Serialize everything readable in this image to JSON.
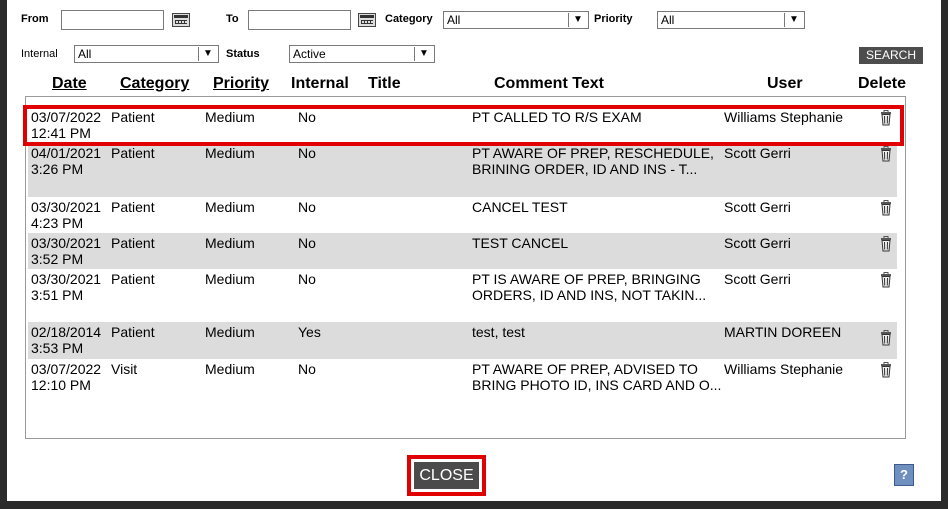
{
  "filters": {
    "from_label": "From",
    "from_value": "",
    "to_label": "To",
    "to_value": "",
    "category_label": "Category",
    "category_value": "All",
    "priority_label": "Priority",
    "priority_value": "All",
    "internal_label": "Internal",
    "internal_value": "All",
    "status_label": "Status",
    "status_value": "Active",
    "search_label": "SEARCH"
  },
  "table": {
    "headers": {
      "date": "Date",
      "category": "Category",
      "priority": "Priority",
      "internal": "Internal",
      "title": "Title",
      "comment": "Comment Text",
      "user": "User",
      "delete": "Delete"
    },
    "rows": [
      {
        "date": "03/07/2022 12:41 PM",
        "category": "Patient",
        "priority": "Medium",
        "internal": "No",
        "title": "",
        "comment": "PT CALLED TO R/S EXAM",
        "user": "Williams Stephanie"
      },
      {
        "date": "04/01/2021 3:26 PM",
        "category": "Patient",
        "priority": "Medium",
        "internal": "No",
        "title": "",
        "comment": "PT AWARE OF PREP, RESCHEDULE, BRINING ORDER, ID AND INS - T...",
        "user": "Scott Gerri"
      },
      {
        "date": "03/30/2021 4:23 PM",
        "category": "Patient",
        "priority": "Medium",
        "internal": "No",
        "title": "",
        "comment": "CANCEL TEST",
        "user": "Scott Gerri"
      },
      {
        "date": "03/30/2021 3:52 PM",
        "category": "Patient",
        "priority": "Medium",
        "internal": "No",
        "title": "",
        "comment": "TEST CANCEL",
        "user": "Scott Gerri"
      },
      {
        "date": "03/30/2021 3:51 PM",
        "category": "Patient",
        "priority": "Medium",
        "internal": "No",
        "title": "",
        "comment": "PT IS AWARE OF PREP, BRINGING ORDERS, ID AND INS, NOT TAKIN...",
        "user": "Scott Gerri"
      },
      {
        "date": "02/18/2014 3:53 PM",
        "category": "Patient",
        "priority": "Medium",
        "internal": "Yes",
        "title": "",
        "comment": "test, test",
        "user": "MARTIN DOREEN"
      },
      {
        "date": "03/07/2022 12:10 PM",
        "category": "Visit",
        "priority": "Medium",
        "internal": "No",
        "title": "",
        "comment": "PT AWARE OF PREP, ADVISED TO BRING PHOTO ID, INS CARD AND O...",
        "user": "Williams Stephanie"
      }
    ]
  },
  "footer": {
    "close_label": "CLOSE",
    "help_label": "?"
  },
  "colors": {
    "highlight": "#e00000",
    "row_alt": "#dcdcdc",
    "button": "#4b4b4b"
  }
}
